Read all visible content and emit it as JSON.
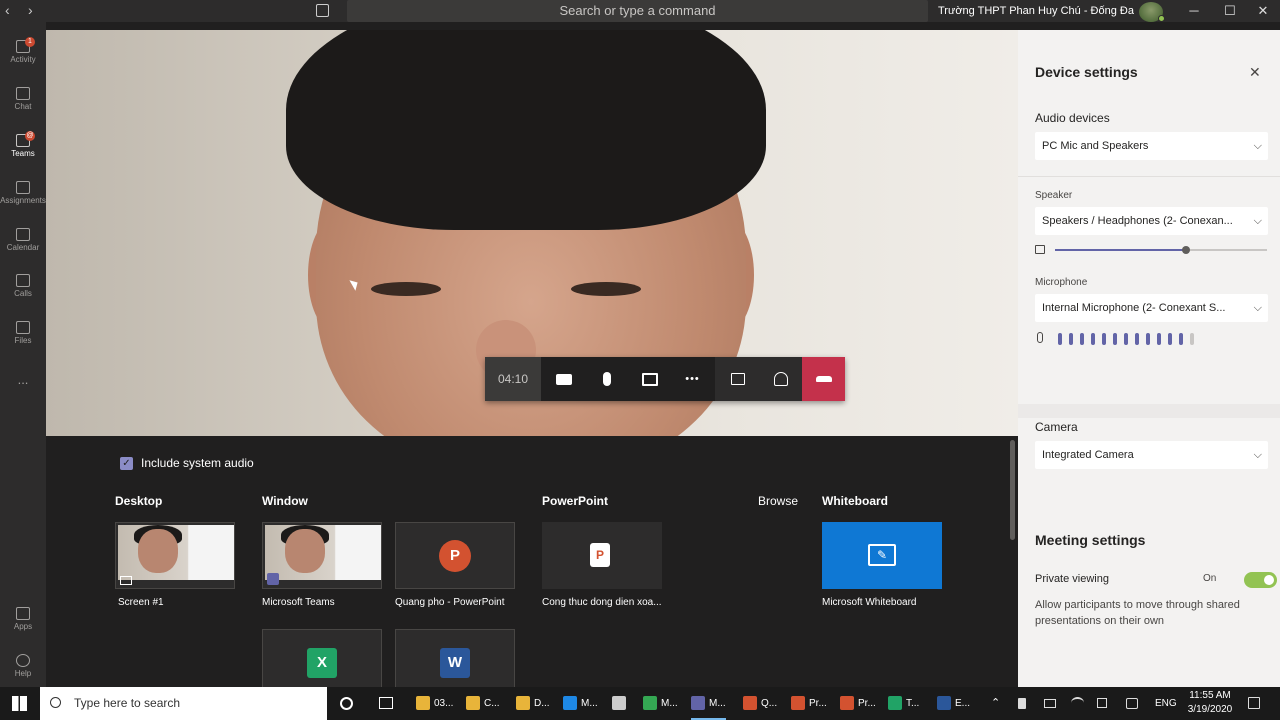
{
  "titlebar": {
    "search_placeholder": "Search or type a command",
    "org_name": "Trường THPT Phan Huy Chú - Đống Đa",
    "back_glyph": "‹",
    "forward_glyph": "›",
    "minimize_glyph": "─",
    "maximize_glyph": "☐",
    "close_glyph": "✕"
  },
  "rail": {
    "items": [
      {
        "label": "Activity",
        "icon": "bell-icon",
        "badge": "1"
      },
      {
        "label": "Chat",
        "icon": "chat-icon"
      },
      {
        "label": "Teams",
        "icon": "teams-icon",
        "badge": "@"
      },
      {
        "label": "Assignments",
        "icon": "assignments-icon"
      },
      {
        "label": "Calendar",
        "icon": "calendar-icon"
      },
      {
        "label": "Calls",
        "icon": "phone-icon"
      },
      {
        "label": "Files",
        "icon": "files-icon"
      },
      {
        "label": "...",
        "icon": "more-icon"
      },
      {
        "label": "Apps",
        "icon": "apps-icon"
      },
      {
        "label": "Help",
        "icon": "help-icon"
      }
    ]
  },
  "callbar": {
    "timer": "04:10",
    "more_glyph": "•••"
  },
  "share": {
    "include_audio_label": "Include system audio",
    "include_audio_checked": true,
    "sections": {
      "desktop": "Desktop",
      "window": "Window",
      "powerpoint": "PowerPoint",
      "browse": "Browse",
      "whiteboard": "Whiteboard"
    },
    "items": {
      "screen": "Screen #1",
      "teams": "Microsoft Teams",
      "ppt1": "Quang pho - PowerPoint",
      "ppt2": "Cong thuc dong dien xoa...",
      "whiteboard": "Microsoft Whiteboard"
    },
    "app_letters": {
      "ppt": "P",
      "excel": "X",
      "word": "W"
    }
  },
  "device_settings": {
    "title": "Device settings",
    "audio_devices_label": "Audio devices",
    "audio_device": "PC Mic and Speakers",
    "speaker_label": "Speaker",
    "speaker": "Speakers / Headphones (2- Conexan...",
    "volume": 0.62,
    "microphone_label": "Microphone",
    "microphone": "Internal Microphone (2- Conexant S...",
    "mic_level_bars": 13,
    "mic_level_active": 12,
    "camera_label": "Camera",
    "camera": "Integrated Camera"
  },
  "meeting_settings": {
    "title": "Meeting settings",
    "private_viewing_label": "Private viewing",
    "private_viewing_state": "On",
    "private_viewing_desc": "Allow participants to move through shared presentations on their own"
  },
  "taskbar": {
    "search_placeholder": "Type here to search",
    "apps": [
      {
        "label": "03...",
        "color": "#e8b43a"
      },
      {
        "label": "C...",
        "color": "#e8b43a"
      },
      {
        "label": "D...",
        "color": "#e8b43a"
      },
      {
        "label": "M...",
        "color": "#1e88e5"
      },
      {
        "label": "",
        "color": "#cccccc"
      },
      {
        "label": "M...",
        "color": "#34a853"
      },
      {
        "label": "M...",
        "color": "#6264a7"
      },
      {
        "label": "Q...",
        "color": "#d35230"
      },
      {
        "label": "Pr...",
        "color": "#d35230"
      },
      {
        "label": "Pr...",
        "color": "#d35230"
      },
      {
        "label": "T...",
        "color": "#21a366"
      },
      {
        "label": "E...",
        "color": "#2b579a"
      }
    ],
    "lang": "ENG",
    "time": "11:55 AM",
    "date": "3/19/2020"
  },
  "colors": {
    "accent": "#6264a7",
    "hangup": "#c4314b",
    "toggle_on": "#92c353",
    "whiteboard": "#0f78d4"
  }
}
